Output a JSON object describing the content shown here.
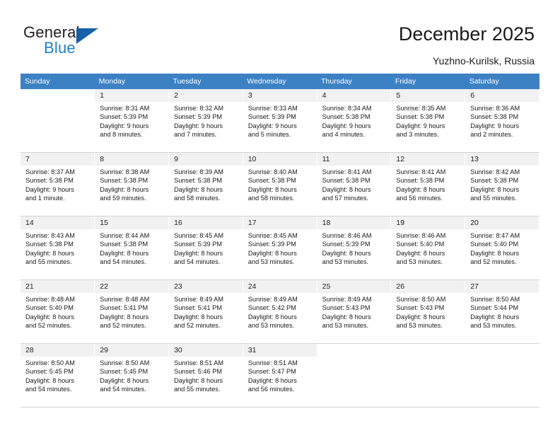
{
  "brand": {
    "name_top": "General",
    "name_bottom": "Blue",
    "accent_color": "#1560a8",
    "text_color": "#231f20"
  },
  "header": {
    "title": "December 2025",
    "subtitle": "Yuzhno-Kurilsk, Russia"
  },
  "theme": {
    "header_row_bg": "#3c81c4",
    "daynum_bg": "#f1f1f1",
    "grid_line": "#d4d4d4"
  },
  "calendar": {
    "weekdays": [
      "Sunday",
      "Monday",
      "Tuesday",
      "Wednesday",
      "Thursday",
      "Friday",
      "Saturday"
    ],
    "weeks": [
      [
        {
          "day": "",
          "sunrise": "",
          "sunset": "",
          "daylight_1": "",
          "daylight_2": ""
        },
        {
          "day": "1",
          "sunrise": "Sunrise: 8:31 AM",
          "sunset": "Sunset: 5:39 PM",
          "daylight_1": "Daylight: 9 hours",
          "daylight_2": "and 8 minutes."
        },
        {
          "day": "2",
          "sunrise": "Sunrise: 8:32 AM",
          "sunset": "Sunset: 5:39 PM",
          "daylight_1": "Daylight: 9 hours",
          "daylight_2": "and 7 minutes."
        },
        {
          "day": "3",
          "sunrise": "Sunrise: 8:33 AM",
          "sunset": "Sunset: 5:39 PM",
          "daylight_1": "Daylight: 9 hours",
          "daylight_2": "and 5 minutes."
        },
        {
          "day": "4",
          "sunrise": "Sunrise: 8:34 AM",
          "sunset": "Sunset: 5:38 PM",
          "daylight_1": "Daylight: 9 hours",
          "daylight_2": "and 4 minutes."
        },
        {
          "day": "5",
          "sunrise": "Sunrise: 8:35 AM",
          "sunset": "Sunset: 5:38 PM",
          "daylight_1": "Daylight: 9 hours",
          "daylight_2": "and 3 minutes."
        },
        {
          "day": "6",
          "sunrise": "Sunrise: 8:36 AM",
          "sunset": "Sunset: 5:38 PM",
          "daylight_1": "Daylight: 9 hours",
          "daylight_2": "and 2 minutes."
        }
      ],
      [
        {
          "day": "7",
          "sunrise": "Sunrise: 8:37 AM",
          "sunset": "Sunset: 5:38 PM",
          "daylight_1": "Daylight: 9 hours",
          "daylight_2": "and 1 minute."
        },
        {
          "day": "8",
          "sunrise": "Sunrise: 8:38 AM",
          "sunset": "Sunset: 5:38 PM",
          "daylight_1": "Daylight: 8 hours",
          "daylight_2": "and 59 minutes."
        },
        {
          "day": "9",
          "sunrise": "Sunrise: 8:39 AM",
          "sunset": "Sunset: 5:38 PM",
          "daylight_1": "Daylight: 8 hours",
          "daylight_2": "and 58 minutes."
        },
        {
          "day": "10",
          "sunrise": "Sunrise: 8:40 AM",
          "sunset": "Sunset: 5:38 PM",
          "daylight_1": "Daylight: 8 hours",
          "daylight_2": "and 58 minutes."
        },
        {
          "day": "11",
          "sunrise": "Sunrise: 8:41 AM",
          "sunset": "Sunset: 5:38 PM",
          "daylight_1": "Daylight: 8 hours",
          "daylight_2": "and 57 minutes."
        },
        {
          "day": "12",
          "sunrise": "Sunrise: 8:41 AM",
          "sunset": "Sunset: 5:38 PM",
          "daylight_1": "Daylight: 8 hours",
          "daylight_2": "and 56 minutes."
        },
        {
          "day": "13",
          "sunrise": "Sunrise: 8:42 AM",
          "sunset": "Sunset: 5:38 PM",
          "daylight_1": "Daylight: 8 hours",
          "daylight_2": "and 55 minutes."
        }
      ],
      [
        {
          "day": "14",
          "sunrise": "Sunrise: 8:43 AM",
          "sunset": "Sunset: 5:38 PM",
          "daylight_1": "Daylight: 8 hours",
          "daylight_2": "and 55 minutes."
        },
        {
          "day": "15",
          "sunrise": "Sunrise: 8:44 AM",
          "sunset": "Sunset: 5:38 PM",
          "daylight_1": "Daylight: 8 hours",
          "daylight_2": "and 54 minutes."
        },
        {
          "day": "16",
          "sunrise": "Sunrise: 8:45 AM",
          "sunset": "Sunset: 5:39 PM",
          "daylight_1": "Daylight: 8 hours",
          "daylight_2": "and 54 minutes."
        },
        {
          "day": "17",
          "sunrise": "Sunrise: 8:45 AM",
          "sunset": "Sunset: 5:39 PM",
          "daylight_1": "Daylight: 8 hours",
          "daylight_2": "and 53 minutes."
        },
        {
          "day": "18",
          "sunrise": "Sunrise: 8:46 AM",
          "sunset": "Sunset: 5:39 PM",
          "daylight_1": "Daylight: 8 hours",
          "daylight_2": "and 53 minutes."
        },
        {
          "day": "19",
          "sunrise": "Sunrise: 8:46 AM",
          "sunset": "Sunset: 5:40 PM",
          "daylight_1": "Daylight: 8 hours",
          "daylight_2": "and 53 minutes."
        },
        {
          "day": "20",
          "sunrise": "Sunrise: 8:47 AM",
          "sunset": "Sunset: 5:40 PM",
          "daylight_1": "Daylight: 8 hours",
          "daylight_2": "and 52 minutes."
        }
      ],
      [
        {
          "day": "21",
          "sunrise": "Sunrise: 8:48 AM",
          "sunset": "Sunset: 5:40 PM",
          "daylight_1": "Daylight: 8 hours",
          "daylight_2": "and 52 minutes."
        },
        {
          "day": "22",
          "sunrise": "Sunrise: 8:48 AM",
          "sunset": "Sunset: 5:41 PM",
          "daylight_1": "Daylight: 8 hours",
          "daylight_2": "and 52 minutes."
        },
        {
          "day": "23",
          "sunrise": "Sunrise: 8:49 AM",
          "sunset": "Sunset: 5:41 PM",
          "daylight_1": "Daylight: 8 hours",
          "daylight_2": "and 52 minutes."
        },
        {
          "day": "24",
          "sunrise": "Sunrise: 8:49 AM",
          "sunset": "Sunset: 5:42 PM",
          "daylight_1": "Daylight: 8 hours",
          "daylight_2": "and 53 minutes."
        },
        {
          "day": "25",
          "sunrise": "Sunrise: 8:49 AM",
          "sunset": "Sunset: 5:43 PM",
          "daylight_1": "Daylight: 8 hours",
          "daylight_2": "and 53 minutes."
        },
        {
          "day": "26",
          "sunrise": "Sunrise: 8:50 AM",
          "sunset": "Sunset: 5:43 PM",
          "daylight_1": "Daylight: 8 hours",
          "daylight_2": "and 53 minutes."
        },
        {
          "day": "27",
          "sunrise": "Sunrise: 8:50 AM",
          "sunset": "Sunset: 5:44 PM",
          "daylight_1": "Daylight: 8 hours",
          "daylight_2": "and 53 minutes."
        }
      ],
      [
        {
          "day": "28",
          "sunrise": "Sunrise: 8:50 AM",
          "sunset": "Sunset: 5:45 PM",
          "daylight_1": "Daylight: 8 hours",
          "daylight_2": "and 54 minutes."
        },
        {
          "day": "29",
          "sunrise": "Sunrise: 8:50 AM",
          "sunset": "Sunset: 5:45 PM",
          "daylight_1": "Daylight: 8 hours",
          "daylight_2": "and 54 minutes."
        },
        {
          "day": "30",
          "sunrise": "Sunrise: 8:51 AM",
          "sunset": "Sunset: 5:46 PM",
          "daylight_1": "Daylight: 8 hours",
          "daylight_2": "and 55 minutes."
        },
        {
          "day": "31",
          "sunrise": "Sunrise: 8:51 AM",
          "sunset": "Sunset: 5:47 PM",
          "daylight_1": "Daylight: 8 hours",
          "daylight_2": "and 56 minutes."
        },
        {
          "day": "",
          "sunrise": "",
          "sunset": "",
          "daylight_1": "",
          "daylight_2": ""
        },
        {
          "day": "",
          "sunrise": "",
          "sunset": "",
          "daylight_1": "",
          "daylight_2": ""
        },
        {
          "day": "",
          "sunrise": "",
          "sunset": "",
          "daylight_1": "",
          "daylight_2": ""
        }
      ]
    ]
  }
}
